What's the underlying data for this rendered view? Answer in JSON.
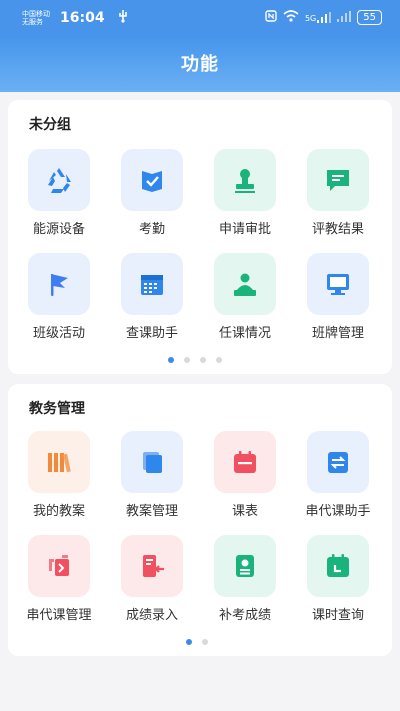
{
  "status_bar": {
    "carrier_line1": "中国移动",
    "carrier_line2": "无服务",
    "time": "16:04",
    "usb_icon": "usb-icon",
    "signal_text": "5G",
    "battery": "55"
  },
  "header": {
    "title": "功能"
  },
  "sections": [
    {
      "title": "未分组",
      "items": [
        {
          "label": "能源设备",
          "icon": "recycle-icon",
          "color": "#2f86eb"
        },
        {
          "label": "考勤",
          "icon": "checkbook-icon",
          "color": "#2f86eb"
        },
        {
          "label": "申请审批",
          "icon": "stamp-icon",
          "color": "#19b37b"
        },
        {
          "label": "评教结果",
          "icon": "chat-icon",
          "color": "#19b37b"
        },
        {
          "label": "班级活动",
          "icon": "flag-icon",
          "color": "#3f7ef0"
        },
        {
          "label": "查课助手",
          "icon": "calendar-grid-icon",
          "color": "#2f86eb"
        },
        {
          "label": "任课情况",
          "icon": "teacher-icon",
          "color": "#19b37b"
        },
        {
          "label": "班牌管理",
          "icon": "monitor-icon",
          "color": "#2f86eb"
        }
      ],
      "page_count": 4,
      "active_page": 1
    },
    {
      "title": "教务管理",
      "items": [
        {
          "label": "我的教案",
          "icon": "books-icon",
          "color": "#f28a3c"
        },
        {
          "label": "教案管理",
          "icon": "stack-icon",
          "color": "#2f86eb"
        },
        {
          "label": "课表",
          "icon": "calendar-icon",
          "color": "#f0505f"
        },
        {
          "label": "串代课助手",
          "icon": "swap-icon",
          "color": "#2f86eb"
        },
        {
          "label": "串代课管理",
          "icon": "swap-doc-icon",
          "color": "#f0505f"
        },
        {
          "label": "成绩录入",
          "icon": "score-entry-icon",
          "color": "#f0505f"
        },
        {
          "label": "补考成绩",
          "icon": "makeup-icon",
          "color": "#19b37b"
        },
        {
          "label": "课时查询",
          "icon": "lesson-query-icon",
          "color": "#19b37b"
        }
      ],
      "page_count": 2,
      "active_page": 1
    }
  ]
}
